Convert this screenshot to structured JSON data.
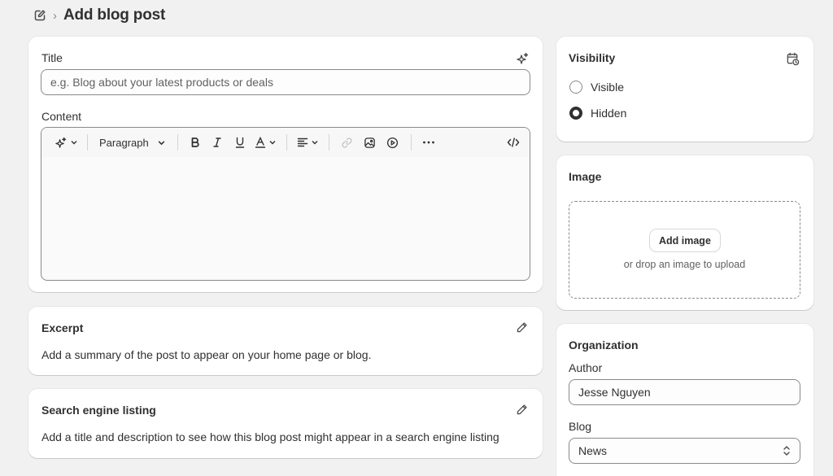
{
  "header": {
    "page_title": "Add blog post"
  },
  "post": {
    "title_label": "Title",
    "title_placeholder": "e.g. Blog about your latest products or deals",
    "content_label": "Content",
    "toolbar": {
      "format_select": "Paragraph"
    }
  },
  "excerpt": {
    "heading": "Excerpt",
    "description": "Add a summary of the post to appear on your home page or blog."
  },
  "seo": {
    "heading": "Search engine listing",
    "description": "Add a title and description to see how this blog post might appear in a search engine listing"
  },
  "visibility": {
    "heading": "Visibility",
    "options": [
      {
        "label": "Visible",
        "selected": false
      },
      {
        "label": "Hidden",
        "selected": true
      }
    ]
  },
  "image": {
    "heading": "Image",
    "add_button": "Add image",
    "drop_hint": "or drop an image to upload"
  },
  "organization": {
    "heading": "Organization",
    "author_label": "Author",
    "author_value": "Jesse Nguyen",
    "blog_label": "Blog",
    "blog_value": "News"
  },
  "icons": {
    "page": "edit-document-icon",
    "ai": "magic-sparkle-icon",
    "schedule": "calendar-clock-icon",
    "edit": "pencil-icon"
  }
}
